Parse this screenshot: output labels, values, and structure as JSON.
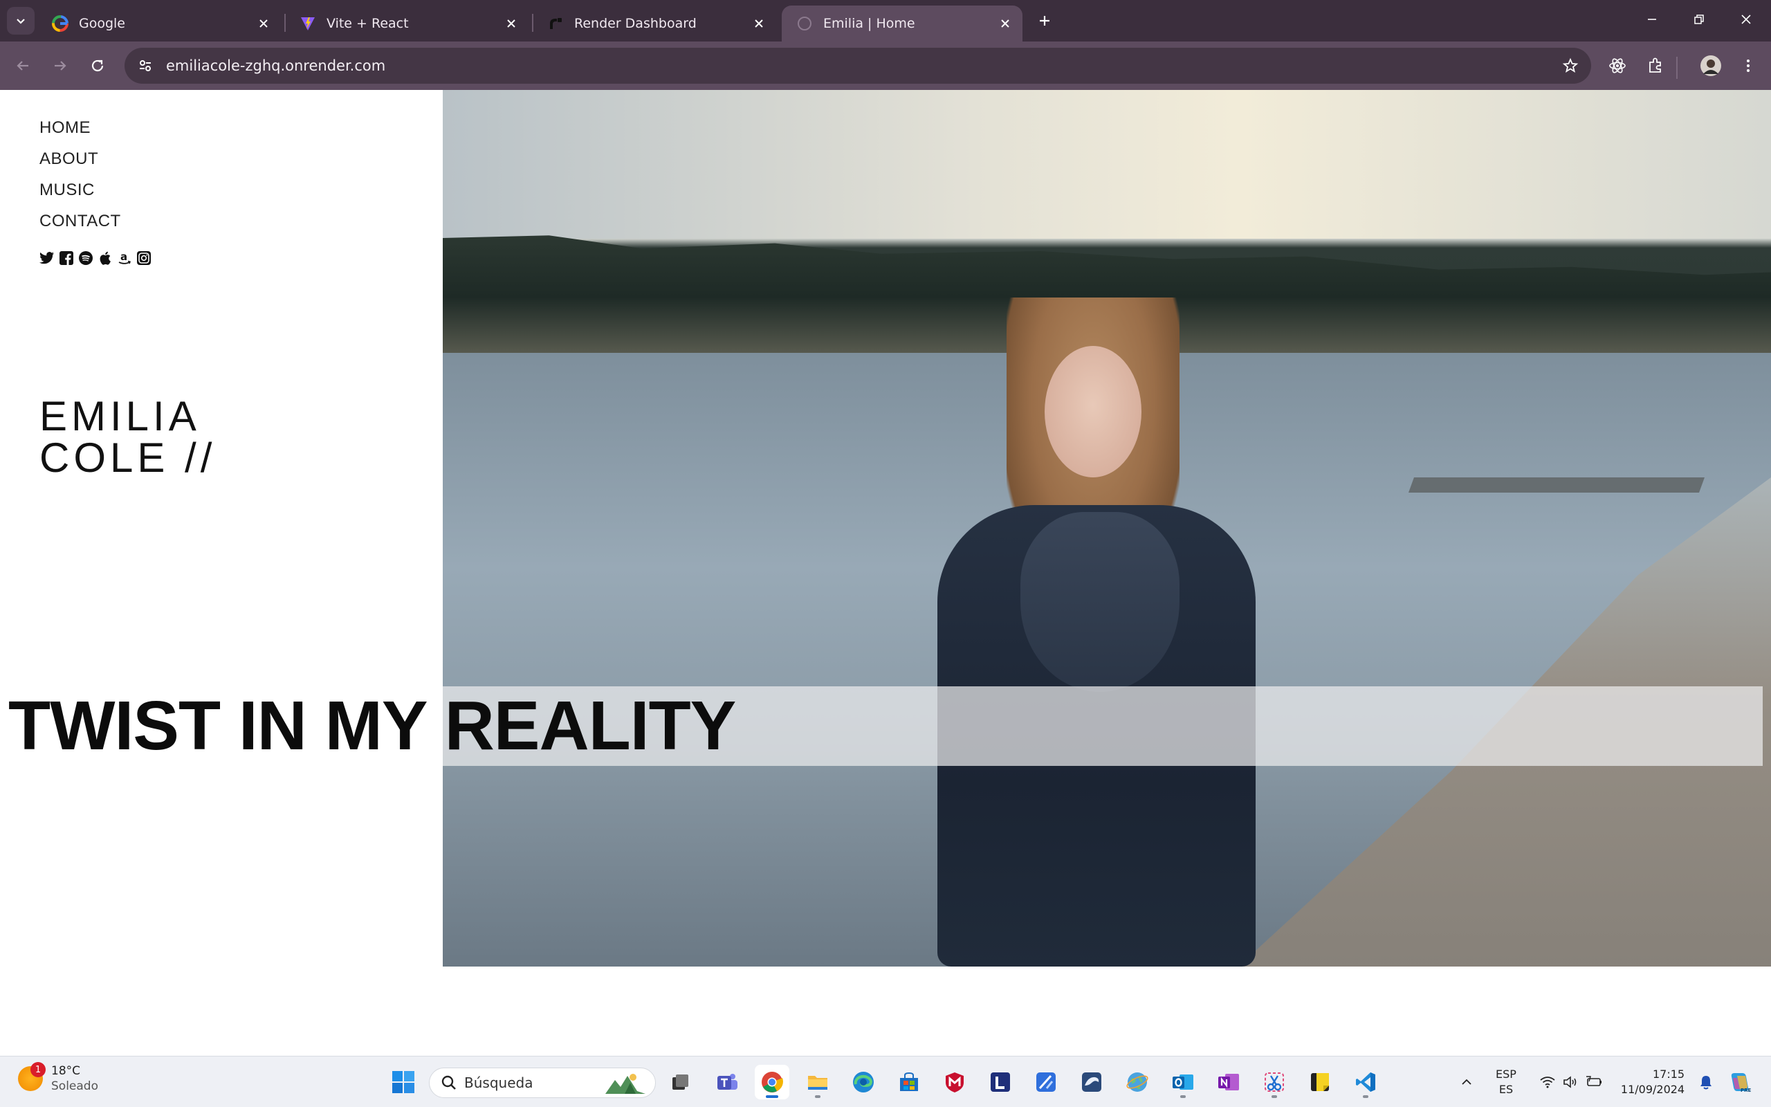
{
  "browser": {
    "tabs": [
      {
        "title": "Google",
        "favicon": "google-icon",
        "active": false
      },
      {
        "title": "Vite + React",
        "favicon": "vite-icon",
        "active": false
      },
      {
        "title": "Render Dashboard",
        "favicon": "render-icon",
        "active": false
      },
      {
        "title": "Emilia | Home",
        "favicon": "loading-globe-icon",
        "active": true
      }
    ],
    "url": "emiliacole-zghq.onrender.com"
  },
  "site": {
    "nav": [
      "HOME",
      "ABOUT",
      "MUSIC",
      "CONTACT"
    ],
    "socials": [
      "twitter-icon",
      "facebook-icon",
      "spotify-icon",
      "apple-icon",
      "amazon-icon",
      "instagram-icon"
    ],
    "artist_line1": "EMILIA",
    "artist_line2": "COLE //",
    "headline": "TWIST IN MY REALITY"
  },
  "taskbar": {
    "weather": {
      "temp": "18°C",
      "condition": "Soleado",
      "badge": "1"
    },
    "search_placeholder": "Búsqueda",
    "lang_top": "ESP",
    "lang_bottom": "ES",
    "time": "17:15",
    "date": "11/09/2024",
    "apps": [
      "start-icon",
      "task-view-icon",
      "teams-icon",
      "chrome-icon",
      "file-explorer-icon",
      "edge-icon",
      "store-icon",
      "mcafee-icon",
      "l-app-icon",
      "vector-app-icon",
      "sql-dolphin-icon",
      "globe-app-icon",
      "outlook-icon",
      "onenote-icon",
      "snipping-tool-icon",
      "sticky-notes-icon",
      "vscode-icon"
    ]
  },
  "colors": {
    "tabstrip": "#3b2e3d",
    "toolbar": "#5d4b5f",
    "omnibox": "#443645",
    "taskbar": "#eef0f5"
  }
}
